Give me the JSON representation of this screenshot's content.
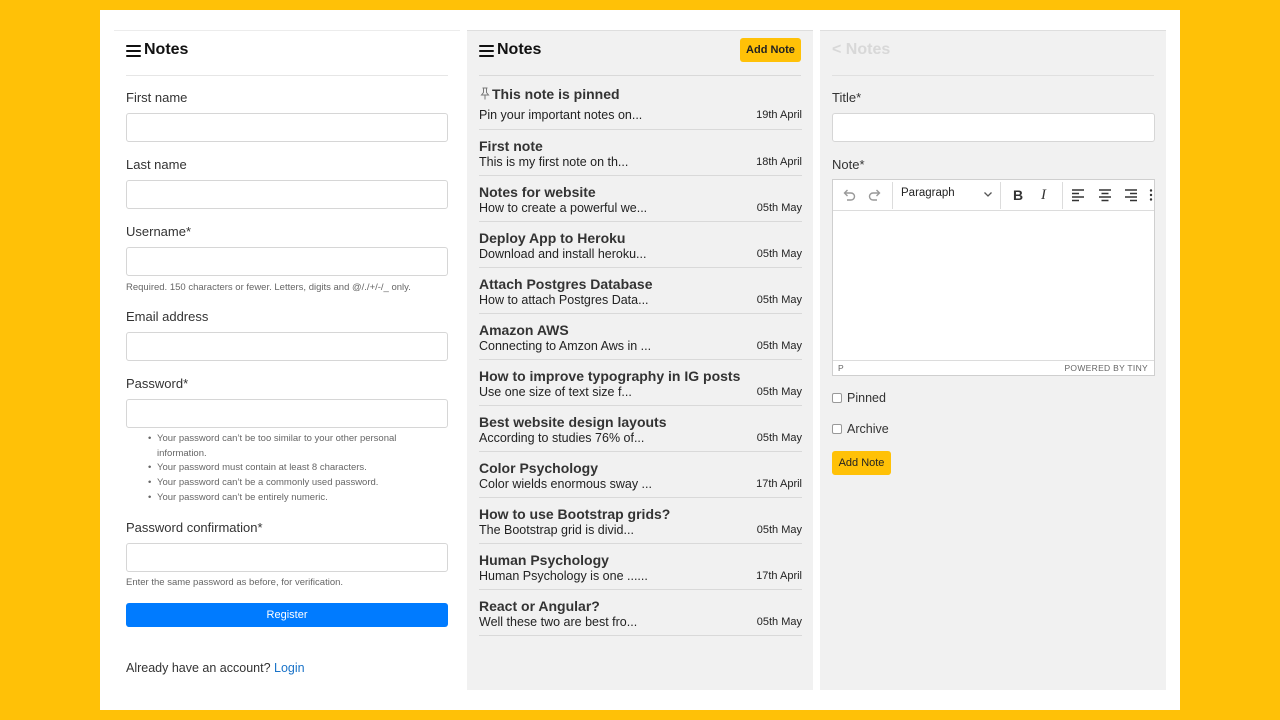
{
  "brand": "Notes",
  "register_form": {
    "fields": {
      "first_name": "First name",
      "last_name": "Last name",
      "username": "Username*",
      "username_help": "Required. 150 characters or fewer. Letters, digits and @/./+/-/_ only.",
      "email": "Email address",
      "password": "Password*",
      "password_rules": [
        "Your password can’t be too similar to your other personal",
        "information.",
        "Your password must contain at least 8 characters.",
        "Your password can’t be a commonly used password.",
        "Your password can’t be entirely numeric."
      ],
      "password_confirmation": "Password confirmation*",
      "confirmation_help": "Enter the same password as before, for verification."
    },
    "register_button": "Register",
    "already_text": "Already have an account?",
    "login_link": "Login"
  },
  "notes_list": {
    "add_button": "Add Note",
    "notes": [
      {
        "title": "This note is pinned",
        "snippet": "Pin your important notes on...",
        "date": "19th April",
        "pinned": true
      },
      {
        "title": "First note",
        "snippet": "This is my first note on th...",
        "date": "18th April"
      },
      {
        "title": "Notes for website",
        "snippet": "How to create a powerful we...",
        "date": "05th May"
      },
      {
        "title": "Deploy App to Heroku",
        "snippet": "Download and install heroku...",
        "date": "05th May"
      },
      {
        "title": "Attach Postgres Database",
        "snippet": "How to attach Postgres Data...",
        "date": "05th May"
      },
      {
        "title": "Amazon AWS",
        "snippet": "Connecting to Amzon Aws in ...",
        "date": "05th May"
      },
      {
        "title": "How to improve typography in IG posts",
        "snippet": "Use one size of text size f...",
        "date": "05th May"
      },
      {
        "title": "Best website design layouts",
        "snippet": "According to studies 76% of...",
        "date": "05th May"
      },
      {
        "title": "Color Psychology",
        "snippet": "Color wields enormous sway ...",
        "date": "17th April"
      },
      {
        "title": "How to use Bootstrap grids?",
        "snippet": "The Bootstrap grid is divid...",
        "date": "05th May"
      },
      {
        "title": "Human Psychology",
        "snippet": "Human Psychology is one ......",
        "date": "17th April"
      },
      {
        "title": "React or Angular?",
        "snippet": "Well these two are best fro...",
        "date": "05th May"
      }
    ]
  },
  "add_note": {
    "back_label": "< Notes",
    "title_label": "Title*",
    "note_label": "Note*",
    "format_select": "Paragraph",
    "status_path": "P",
    "powered_by": "POWERED BY TINY",
    "pinned_label": "Pinned",
    "archive_label": "Archive",
    "submit": "Add Note"
  },
  "colors": {
    "background": "#FFC107",
    "accent": "#FFC107",
    "primary_button": "#007BFF",
    "link": "#1a73c8"
  },
  "icons": [
    "menu-icon",
    "pin-icon",
    "undo-icon",
    "redo-icon",
    "chevron-down-icon",
    "bold-icon",
    "italic-icon",
    "align-left-icon",
    "align-center-icon",
    "align-right-icon",
    "more-icon"
  ]
}
